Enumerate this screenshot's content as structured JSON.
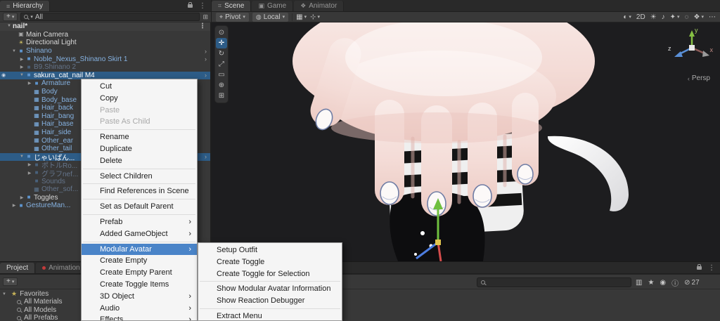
{
  "theme": {
    "selection_blue": "#2d5c87",
    "prefab_text": "#85b1e0",
    "menu_highlight": "#4a84c8",
    "menu_bg": "#f5f5f5",
    "viewport_bg": "#1d1d1f"
  },
  "hierarchy": {
    "tab_label": "Hierarchy",
    "create_label": "+",
    "search_value": "All",
    "scene_name": "nail*",
    "rows": [
      {
        "label": "Main Camera",
        "indent": 1,
        "color": "plain",
        "icon": "camera",
        "arrow": "none"
      },
      {
        "label": "Directional Light",
        "indent": 1,
        "color": "plain",
        "icon": "light",
        "arrow": "none"
      },
      {
        "label": "Shinano",
        "indent": 1,
        "color": "prefab",
        "icon": "cube",
        "arrow": "down",
        "edit": true
      },
      {
        "label": "Noble_Nexus_Shinano Skirt 1",
        "indent": 2,
        "color": "prefab",
        "icon": "cube",
        "arrow": "right",
        "edit": true
      },
      {
        "label": "B9.Shinano 2",
        "indent": 2,
        "color": "dim",
        "icon": "cube",
        "arrow": "right"
      },
      {
        "label": "sakura_cat_nail M4",
        "indent": 2,
        "color": "plain",
        "icon": "cube",
        "arrow": "down",
        "selected": true,
        "edit": true,
        "eye": true
      },
      {
        "label": "Armature",
        "indent": 3,
        "color": "prefab",
        "icon": "cube",
        "arrow": "right"
      },
      {
        "label": "Body",
        "indent": 3,
        "color": "prefab",
        "icon": "mesh",
        "arrow": "none"
      },
      {
        "label": "Body_base",
        "indent": 3,
        "color": "prefab",
        "icon": "mesh",
        "arrow": "none"
      },
      {
        "label": "Hair_back",
        "indent": 3,
        "color": "prefab",
        "icon": "mesh",
        "arrow": "none"
      },
      {
        "label": "Hair_bang",
        "indent": 3,
        "color": "prefab",
        "icon": "mesh",
        "arrow": "none"
      },
      {
        "label": "Hair_base",
        "indent": 3,
        "color": "prefab",
        "icon": "mesh",
        "arrow": "none"
      },
      {
        "label": "Hair_side",
        "indent": 3,
        "color": "prefab",
        "icon": "mesh",
        "arrow": "none"
      },
      {
        "label": "Other_ear",
        "indent": 3,
        "color": "prefab",
        "icon": "mesh",
        "arrow": "none"
      },
      {
        "label": "Other_tail",
        "indent": 3,
        "color": "prefab",
        "icon": "mesh",
        "arrow": "none"
      },
      {
        "label": "じゃいぱん...",
        "indent": 2,
        "color": "plain",
        "icon": "cube",
        "arrow": "down",
        "selected": true,
        "edit": true
      },
      {
        "label": "ポトルRo...",
        "indent": 3,
        "color": "dim",
        "icon": "cube",
        "arrow": "right"
      },
      {
        "label": "グラフnef...",
        "indent": 3,
        "color": "dim",
        "icon": "cube",
        "arrow": "right"
      },
      {
        "label": "Sounds",
        "indent": 3,
        "color": "dim",
        "icon": "cube",
        "arrow": "none"
      },
      {
        "label": "Other_sof...",
        "indent": 3,
        "color": "dim",
        "icon": "mesh",
        "arrow": "none"
      },
      {
        "label": "Toggles",
        "indent": 2,
        "color": "plain",
        "icon": "cube",
        "arrow": "right"
      },
      {
        "label": "GestureMan...",
        "indent": 1,
        "color": "prefab",
        "icon": "cube",
        "arrow": "right"
      }
    ]
  },
  "context_menu": {
    "items": [
      {
        "label": "Cut"
      },
      {
        "label": "Copy"
      },
      {
        "label": "Paste",
        "disabled": true
      },
      {
        "label": "Paste As Child",
        "disabled": true
      },
      {
        "sep": true
      },
      {
        "label": "Rename"
      },
      {
        "label": "Duplicate"
      },
      {
        "label": "Delete"
      },
      {
        "sep": true
      },
      {
        "label": "Select Children"
      },
      {
        "sep": true
      },
      {
        "label": "Find References in Scene"
      },
      {
        "sep": true
      },
      {
        "label": "Set as Default Parent"
      },
      {
        "sep": true
      },
      {
        "label": "Prefab",
        "submenu": true
      },
      {
        "label": "Added GameObject",
        "submenu": true
      },
      {
        "sep": true
      },
      {
        "label": "Modular Avatar",
        "submenu": true,
        "highlight": true
      },
      {
        "label": "Create Empty"
      },
      {
        "label": "Create Empty Parent"
      },
      {
        "label": "Create Toggle Items"
      },
      {
        "label": "3D Object",
        "submenu": true
      },
      {
        "label": "Audio",
        "submenu": true
      },
      {
        "label": "Effects",
        "submenu": true
      }
    ]
  },
  "submenu": {
    "items": [
      {
        "label": "Setup Outfit"
      },
      {
        "label": "Create Toggle"
      },
      {
        "label": "Create Toggle for Selection"
      },
      {
        "sep": true
      },
      {
        "label": "Show Modular Avatar Information"
      },
      {
        "label": "Show Reaction Debugger"
      },
      {
        "sep": true
      },
      {
        "label": "Extract Menu"
      }
    ]
  },
  "scene": {
    "tabs": [
      {
        "label": "Scene",
        "icon": "⌗",
        "active": true
      },
      {
        "label": "Game",
        "icon": "▣"
      },
      {
        "label": "Animator",
        "icon": "❖"
      }
    ],
    "tools": [
      {
        "name": "view-tool-icon",
        "glyph": "⊙"
      },
      {
        "name": "move-tool-icon",
        "glyph": "✛",
        "active": true
      },
      {
        "name": "rotate-tool-icon",
        "glyph": "↻"
      },
      {
        "name": "scale-tool-icon",
        "glyph": "⤢"
      },
      {
        "name": "rect-tool-icon",
        "glyph": "▭"
      },
      {
        "name": "transform-tool-icon",
        "glyph": "⊕"
      },
      {
        "name": "custom-tool-icon",
        "glyph": "⊞"
      }
    ],
    "toolbar": {
      "pivot_label": "Pivot",
      "space_label": "Local",
      "grid_icons": [
        {
          "name": "grid-visibility-icon",
          "glyph": "▦",
          "drop": true
        },
        {
          "name": "snap-settings-icon",
          "glyph": "⊹",
          "drop": true
        }
      ],
      "right": [
        {
          "name": "camera-view-icon",
          "glyph": "◐",
          "drop": true
        },
        {
          "name": "toggle-2d",
          "text": "2D"
        },
        {
          "name": "lighting-toggle-icon",
          "glyph": "☀"
        },
        {
          "name": "audio-toggle-icon",
          "glyph": "♪"
        },
        {
          "name": "effects-toggle-icon",
          "glyph": "✦",
          "drop": true
        },
        {
          "name": "hidden-objects-icon",
          "glyph": "◌"
        },
        {
          "name": "gizmos-dropdown-icon",
          "glyph": "❖",
          "drop": true
        },
        {
          "name": "overflow-menu-icon",
          "glyph": "⋯"
        }
      ]
    },
    "gizmo": {
      "x": "x",
      "y": "y",
      "z": "z",
      "persp": "Persp"
    }
  },
  "project": {
    "tabs": [
      {
        "label": "Project",
        "active": true
      },
      {
        "label": "Animation",
        "dot": true
      }
    ],
    "create_label": "+",
    "counter": "27",
    "favorites_header": "Favorites",
    "favorites": [
      {
        "label": "All Materials"
      },
      {
        "label": "All Models"
      },
      {
        "label": "All Prefabs"
      }
    ],
    "toolbar_icons": [
      {
        "name": "layout-columns-icon",
        "glyph": "▥"
      },
      {
        "name": "favorites-star-icon",
        "glyph": "★"
      },
      {
        "name": "preview-eye-icon",
        "glyph": "◉"
      },
      {
        "name": "info-icon",
        "glyph": "ⓘ"
      }
    ]
  }
}
